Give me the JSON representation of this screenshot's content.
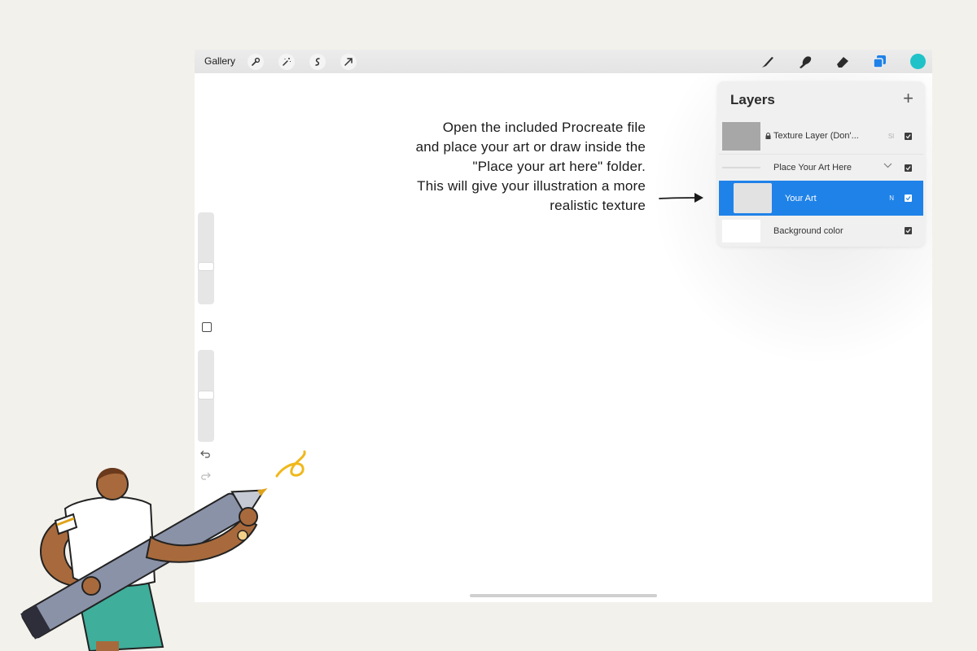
{
  "topbar": {
    "gallery_label": "Gallery",
    "left_tools": [
      "wrench-icon",
      "magic-wand-icon",
      "selection-icon",
      "transform-icon"
    ],
    "right_tools": [
      "brush-icon",
      "smudge-icon",
      "eraser-icon",
      "layers-icon"
    ],
    "color": "#1ec2c8"
  },
  "instruction": {
    "lines": [
      "Open the included Procreate file",
      "and place your art or draw inside the",
      "\"Place your art here\" folder.",
      "This will give your illustration a more",
      "realistic texture"
    ]
  },
  "layers": {
    "title": "Layers",
    "add_label": "+",
    "rows": [
      {
        "name": "Texture Layer (Don'...",
        "mode": "Sl",
        "locked": true,
        "visible": true
      },
      {
        "name": "Place Your Art Here",
        "type": "group",
        "visible": true
      },
      {
        "name": "Your Art",
        "mode": "N",
        "selected": true,
        "visible": true
      },
      {
        "name": "Background color",
        "visible": true
      }
    ]
  },
  "accent_color": "#1f82e8"
}
